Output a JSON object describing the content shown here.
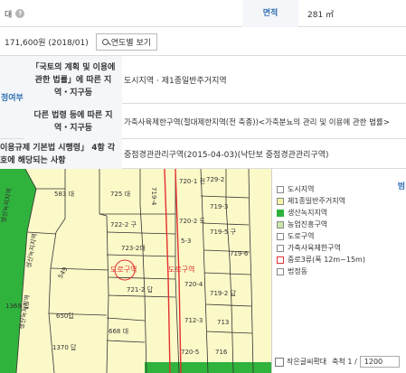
{
  "rows": {
    "r1": {
      "left_text": "대",
      "help_icon": "help-icon",
      "area_header": "면적",
      "area_value": "281 ㎡"
    },
    "r2": {
      "price_text": "171,600원 (2018/01)",
      "button_label": "연도별 보기",
      "button_icon": "search-icon"
    },
    "r3": {
      "side_label": "정여부",
      "label": "「국토의 계획 및 이용에 관한 법률」에 따른 지역・지구등",
      "value": "도시지역 · 제1종일반주거지역"
    },
    "r4": {
      "label": "다른 법령 등에 따른 지역・지구등",
      "value": "가축사육제한구역(절대제한지역(전 축종))<가축분뇨의 관리 및 이용에 관한 법률>"
    },
    "r5": {
      "label": "이용규제 기본법 시행령」 4항 각 호에 해당되는 사항",
      "value": "중점경관관리구역(2015-04-03)(낙단보 중점경관관리구역)"
    }
  },
  "map": {
    "parcels": [
      "583 대",
      "725 대",
      "719-4",
      "720-1 전",
      "729-2",
      "719-3",
      "722-2 구",
      "720-2 도",
      "719-5 구",
      "723-2대",
      "5-3",
      "719-6",
      "721-2 답",
      "549",
      "1369 답",
      "650답",
      "1370 답",
      "668 대",
      "720-4",
      "719-2 답",
      "712-3",
      "713",
      "716",
      "720-5"
    ],
    "zone_labels": [
      "도로구역",
      "도로구역",
      "생산녹지지역",
      "생산녹지지역",
      "생산녹지지역"
    ],
    "colors": {
      "residential": "#fbf9c8",
      "green": "#2fb33c",
      "road": "#e23030",
      "line": "#333333"
    }
  },
  "legend": {
    "title": "범",
    "items": [
      {
        "label": "도시지역",
        "color": "#ffffff",
        "border": "#888888"
      },
      {
        "label": "제1종일반주거지역",
        "color": "#f6f2a6",
        "border": "#888888"
      },
      {
        "label": "생산녹지지역",
        "color": "#2fb33c",
        "border": "#2fb33c"
      },
      {
        "label": "농업진흥구역",
        "color": "#c8e8a8",
        "border": "#888888"
      },
      {
        "label": "도로구역",
        "color": "#ffffff",
        "border": "#888888"
      },
      {
        "label": "가축사육제한구역",
        "color": "#ffffff",
        "border": "#888888"
      },
      {
        "label": "중로3류(폭 12m~15m)",
        "color": "#ffffff",
        "border": "#e23030"
      },
      {
        "label": "법정동",
        "color": "#ffffff",
        "border": "#888888"
      }
    ],
    "zoom_checkbox_label": "작은글씨확대",
    "scale_label": "축척 1 /",
    "scale_value": "1200"
  }
}
